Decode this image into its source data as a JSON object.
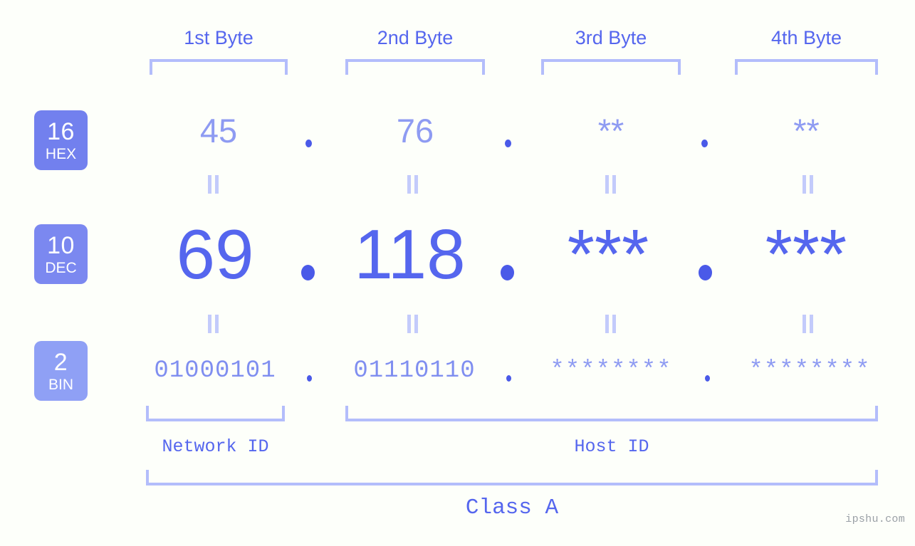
{
  "background_color": "#fdfffa",
  "accent_color": "#5566ee",
  "accent_light_color": "#8e9bf2",
  "bracket_color": "#b3bdfb",
  "byte_headers": [
    {
      "label": "1st Byte"
    },
    {
      "label": "2nd Byte"
    },
    {
      "label": "3rd Byte"
    },
    {
      "label": "4th Byte"
    }
  ],
  "rows": {
    "hex": {
      "badge_number": "16",
      "badge_name": "HEX",
      "badge_color": "#7280ee",
      "values": [
        "45",
        "76",
        "**",
        "**"
      ],
      "separator": "."
    },
    "dec": {
      "badge_number": "10",
      "badge_name": "DEC",
      "badge_color": "#7b88f0",
      "values": [
        "69",
        "118",
        "***",
        "***"
      ],
      "separator": "."
    },
    "bin": {
      "badge_number": "2",
      "badge_name": "BIN",
      "badge_color": "#8fa0f5",
      "values": [
        "01000101",
        "01110110",
        "********",
        "********"
      ],
      "separator": "."
    }
  },
  "equals_symbol": "=",
  "id_sections": [
    {
      "label": "Network ID"
    },
    {
      "label": "Host ID"
    }
  ],
  "class_label": "Class A",
  "watermark": "ipshu.com"
}
